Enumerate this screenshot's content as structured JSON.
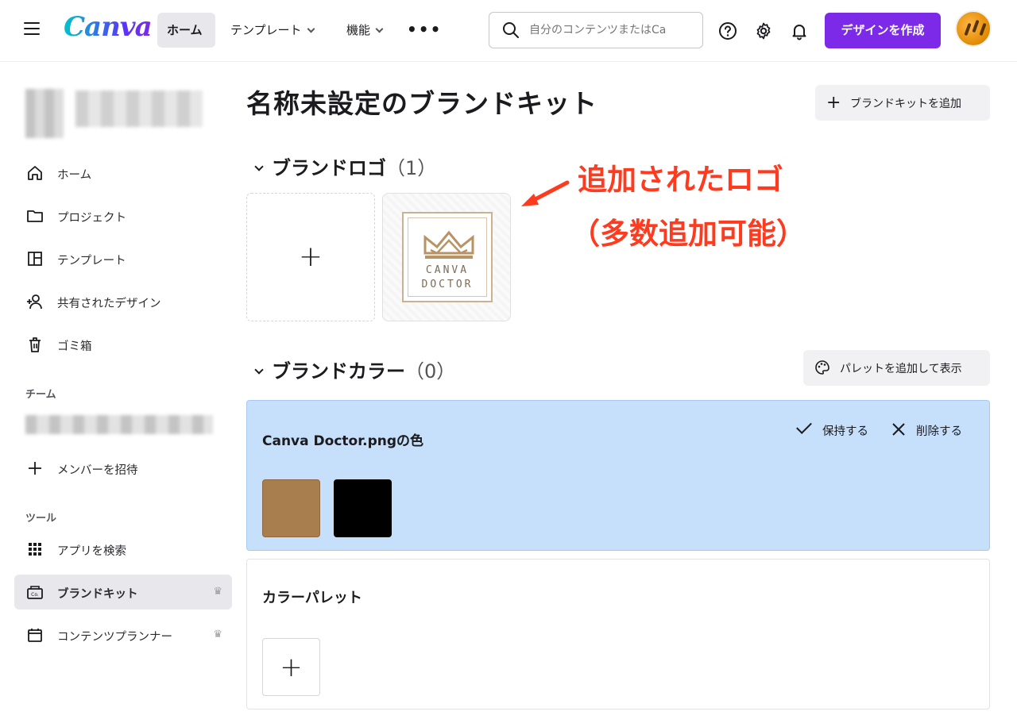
{
  "header": {
    "logo_text": "Canva",
    "nav": [
      {
        "label": "ホーム"
      },
      {
        "label": "テンプレート"
      },
      {
        "label": "機能"
      }
    ],
    "more_label": "•••",
    "search_placeholder": "自分のコンテンツまたはCa",
    "create_button_label": "デザインを作成",
    "accent_color": "#7d2ae8"
  },
  "sidebar": {
    "items": [
      {
        "label": "ホーム",
        "icon": "home-icon"
      },
      {
        "label": "プロジェクト",
        "icon": "folder-icon"
      },
      {
        "label": "テンプレート",
        "icon": "template-icon"
      },
      {
        "label": "共有されたデザイン",
        "icon": "shared-users-icon"
      },
      {
        "label": "ゴミ箱",
        "icon": "trash-icon"
      }
    ],
    "team_section_label": "チーム",
    "invite_label": "メンバーを招待",
    "tools_section_label": "ツール",
    "tools": [
      {
        "label": "アプリを検索",
        "icon": "apps-grid-icon"
      },
      {
        "label": "ブランドキット",
        "icon": "brand-kit-icon",
        "active": true,
        "premium": true
      },
      {
        "label": "コンテンツプランナー",
        "icon": "calendar-icon",
        "premium": true
      }
    ]
  },
  "main": {
    "title": "名称未設定のブランドキット",
    "add_kit_label": "ブランドキットを追加",
    "logo_section": {
      "title": "ブランドロゴ",
      "count": "（1）"
    },
    "logo_card": {
      "line1": "CANVA",
      "line2": "DOCTOR"
    },
    "annotation": {
      "line1": "追加されたロゴ",
      "line2": "（多数追加可能）",
      "color": "#ff3b1f"
    },
    "color_section": {
      "title": "ブランドカラー",
      "count": "（0）"
    },
    "palette_button_label": "パレットを追加して表示",
    "suggestion": {
      "title": "Canva Doctor.pngの色",
      "keep_label": "保持する",
      "delete_label": "削除する",
      "colors": [
        "#a97e4e",
        "#000000"
      ]
    },
    "palette_card": {
      "title": "カラーパレット",
      "add_label": "+"
    }
  }
}
